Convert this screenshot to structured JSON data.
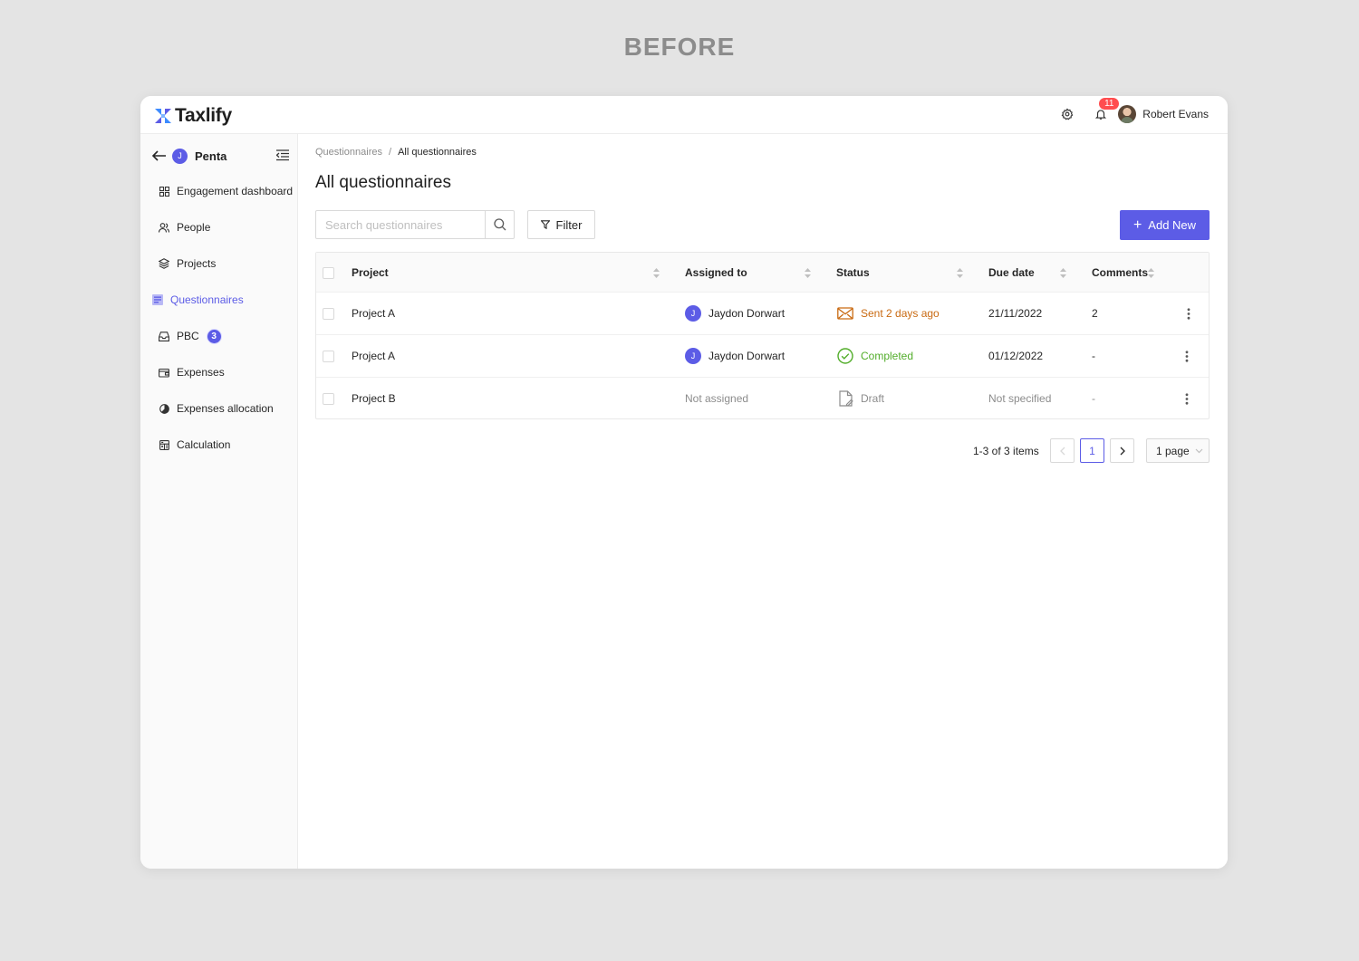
{
  "page_heading": "BEFORE",
  "app": {
    "name": "Taxlify"
  },
  "topbar": {
    "notification_count": "11",
    "user_name": "Robert Evans"
  },
  "sidebar": {
    "project_initial": "J",
    "project_name": "Penta",
    "items": [
      {
        "label": "Engagement dashboard",
        "icon": "grid-icon"
      },
      {
        "label": "People",
        "icon": "users-icon"
      },
      {
        "label": "Projects",
        "icon": "layers-icon"
      },
      {
        "label": "Questionnaires",
        "icon": "form-icon",
        "active": true
      },
      {
        "label": "PBC",
        "icon": "inbox-icon",
        "count": "3"
      },
      {
        "label": "Expenses",
        "icon": "wallet-icon"
      },
      {
        "label": "Expenses allocation",
        "icon": "pie-chart-icon"
      },
      {
        "label": "Calculation",
        "icon": "calculator-icon"
      }
    ]
  },
  "breadcrumb": {
    "parent": "Questionnaires",
    "separator": "/",
    "current": "All questionnaires"
  },
  "page_title": "All questionnaires",
  "search": {
    "placeholder": "Search questionnaires",
    "value": ""
  },
  "filter_label": "Filter",
  "add_new_label": "Add New",
  "table": {
    "columns": [
      "Project",
      "Assigned to",
      "Status",
      "Due date",
      "Comments"
    ],
    "rows": [
      {
        "project": "Project A",
        "assignee_initial": "J",
        "assignee": "Jaydon Dorwart",
        "status": "Sent 2 days ago",
        "status_type": "sent",
        "due_date": "21/11/2022",
        "comments": "2"
      },
      {
        "project": "Project A",
        "assignee_initial": "J",
        "assignee": "Jaydon Dorwart",
        "status": "Completed",
        "status_type": "completed",
        "due_date": "01/12/2022",
        "comments": "-"
      },
      {
        "project": "Project B",
        "assignee_initial": "",
        "assignee": "Not assigned",
        "status": "Draft",
        "status_type": "draft",
        "due_date": "Not specified",
        "comments": "-"
      }
    ]
  },
  "pagination": {
    "total_text": "1-3 of 3 items",
    "current_page": "1",
    "page_size": "1 page"
  },
  "colors": {
    "accent": "#5c5ce6",
    "sent": "#c96a12",
    "completed": "#52ad2a",
    "badge": "#ff4d4f"
  }
}
